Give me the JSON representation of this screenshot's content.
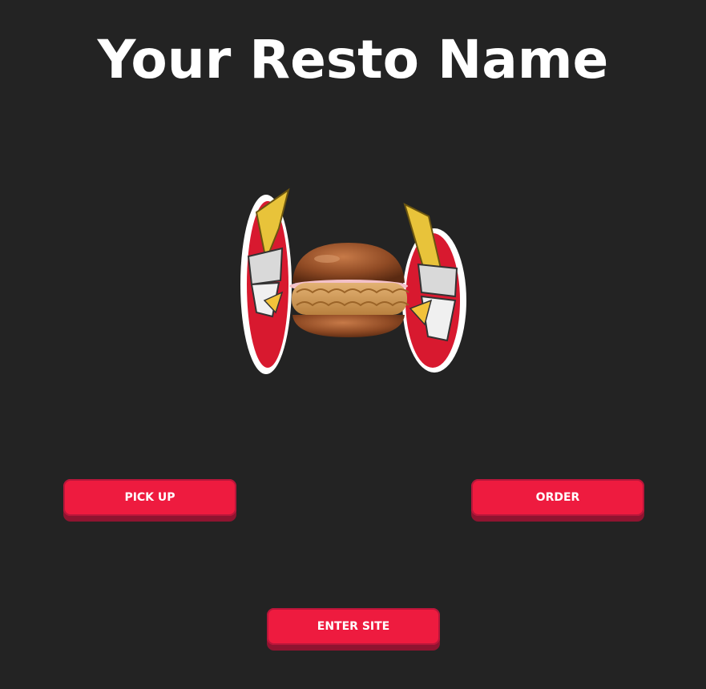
{
  "header": {
    "title": "Your Resto Name"
  },
  "hero": {
    "image": "samurai-chicken-burger-logo"
  },
  "buttons": {
    "pickup_label": "PICK UP",
    "order_label": "ORDER",
    "enter_label": "ENTER SITE"
  },
  "colors": {
    "background": "#232323",
    "accent": "#ee1b3f",
    "accent_shadow": "#8f1430",
    "text": "#ffffff"
  }
}
